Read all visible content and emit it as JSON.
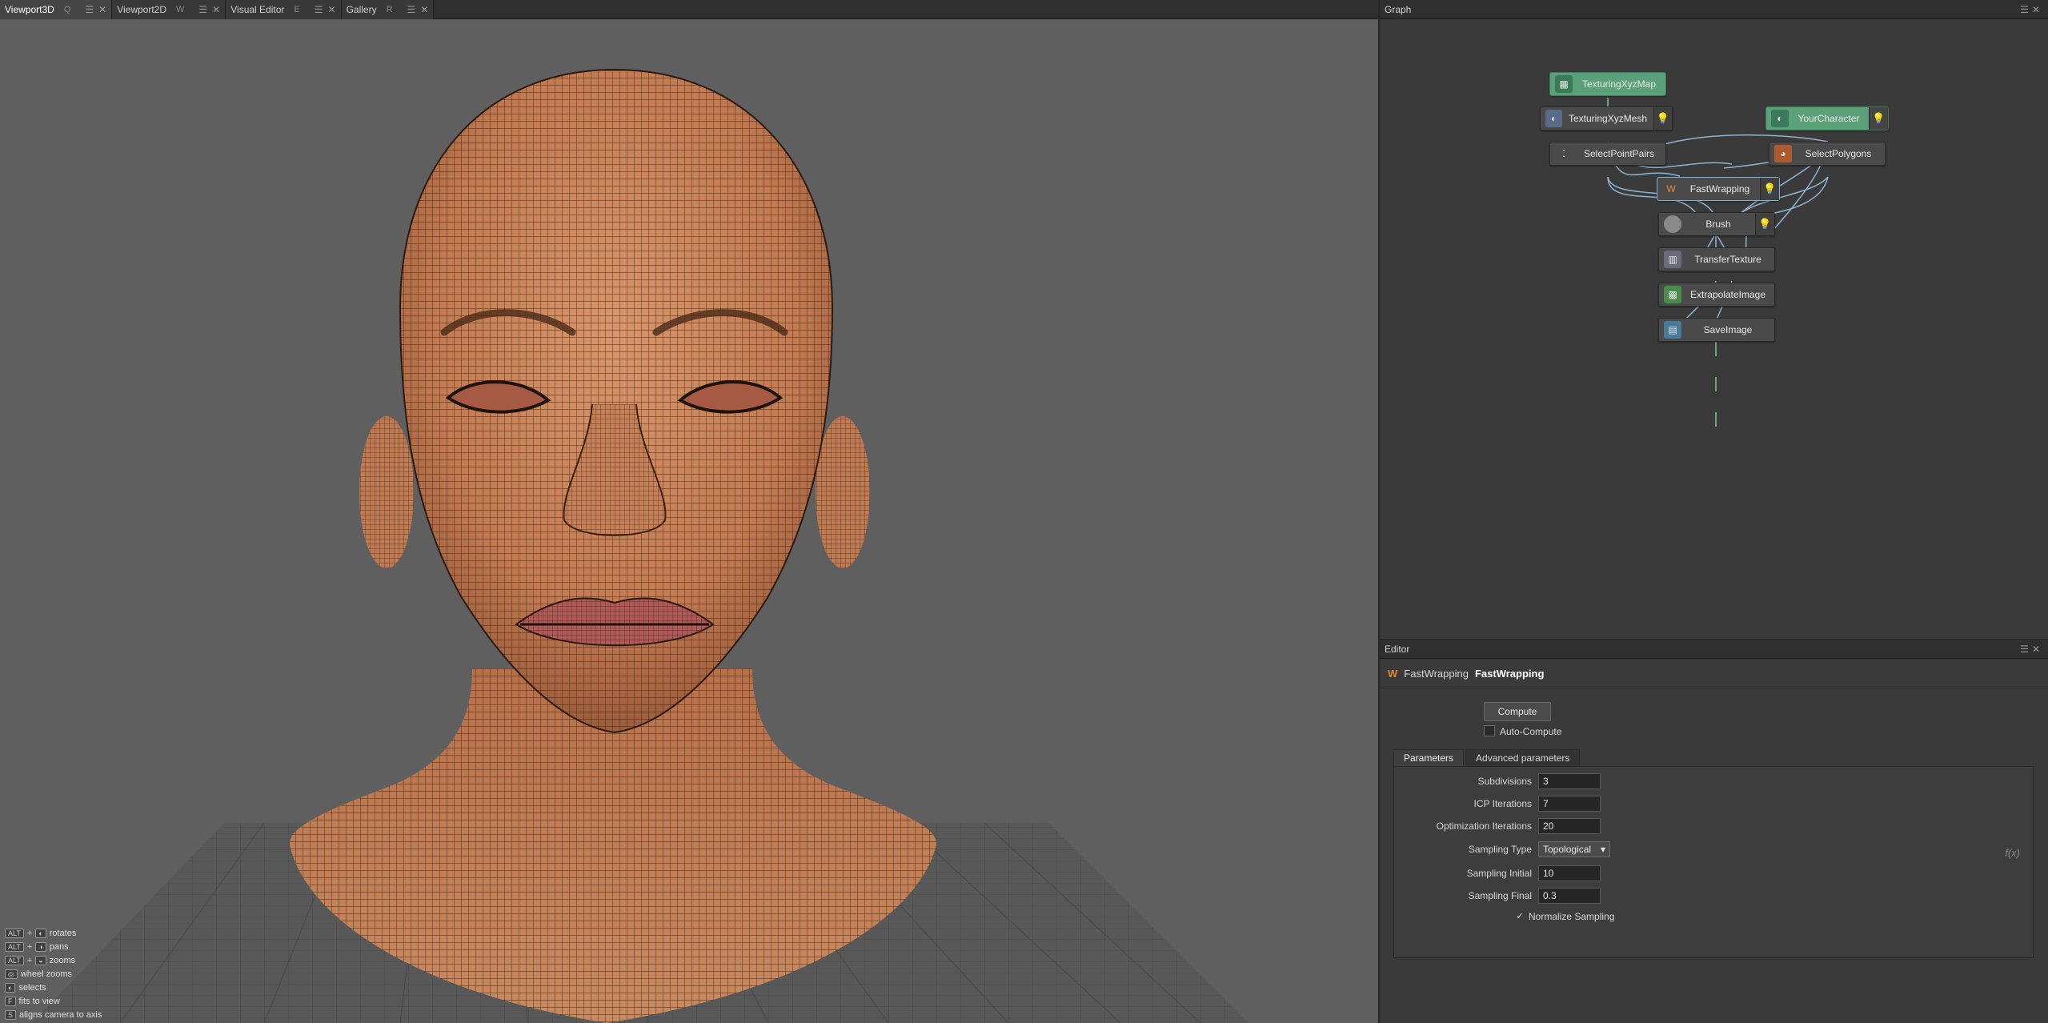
{
  "left_tabs": [
    {
      "label": "Viewport3D",
      "shortcut": "Q"
    },
    {
      "label": "Viewport2D",
      "shortcut": "W"
    },
    {
      "label": "Visual Editor",
      "shortcut": "E"
    },
    {
      "label": "Gallery",
      "shortcut": "R"
    }
  ],
  "icons": {
    "menu": "☰",
    "close": "✕",
    "bulb": "💡",
    "fx": "f(x)",
    "check": "✓",
    "dropdown": "▾"
  },
  "hints": [
    {
      "keys": [
        "ALT",
        "+",
        "◐"
      ],
      "text": "rotates"
    },
    {
      "keys": [
        "ALT",
        "+",
        "◑"
      ],
      "text": "pans"
    },
    {
      "keys": [
        "ALT",
        "+",
        "◒"
      ],
      "text": "zooms"
    },
    {
      "keys": [
        "◎"
      ],
      "text": "wheel zooms"
    },
    {
      "keys": [
        "◐"
      ],
      "text": "selects"
    },
    {
      "keys": [
        "F"
      ],
      "text": "fits to view"
    },
    {
      "keys": [
        "S"
      ],
      "text": "aligns camera to axis"
    }
  ],
  "graph": {
    "title": "Graph",
    "nodes": [
      {
        "id": "n1",
        "label": "TexturingXyzMap",
        "green": true
      },
      {
        "id": "n2",
        "label": "TexturingXyzMesh",
        "green": false
      },
      {
        "id": "n3",
        "label": "YourCharacter",
        "green": true
      },
      {
        "id": "n4",
        "label": "SelectPointPairs",
        "green": false
      },
      {
        "id": "n5",
        "label": "SelectPolygons",
        "green": false
      },
      {
        "id": "n6",
        "label": "FastWrapping",
        "green": false
      },
      {
        "id": "n7",
        "label": "Brush",
        "green": false
      },
      {
        "id": "n8",
        "label": "TransferTexture",
        "green": false
      },
      {
        "id": "n9",
        "label": "ExtrapolateImage",
        "green": false
      },
      {
        "id": "n10",
        "label": "SaveImage",
        "green": false
      }
    ]
  },
  "editor": {
    "title": "Editor",
    "node_type": "FastWrapping",
    "node_name": "FastWrapping",
    "compute_label": "Compute",
    "auto_compute_label": "Auto-Compute",
    "tabs": [
      "Parameters",
      "Advanced parameters"
    ],
    "params": [
      {
        "label": "Subdivisions",
        "value": "3"
      },
      {
        "label": "ICP Iterations",
        "value": "7"
      },
      {
        "label": "Optimization Iterations",
        "value": "20"
      },
      {
        "label": "Sampling Type",
        "value": "Topological"
      },
      {
        "label": "Sampling Initial",
        "value": "10"
      },
      {
        "label": "Sampling Final",
        "value": "0.3"
      }
    ],
    "normalize_label": "Normalize Sampling",
    "normalize_checked": true
  }
}
